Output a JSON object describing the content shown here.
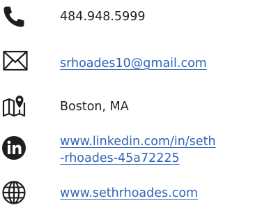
{
  "contact": {
    "phone": {
      "icon": "phone-icon",
      "text": "484.948.5999"
    },
    "email": {
      "icon": "envelope-icon",
      "text": "srhoades10@gmail.com"
    },
    "location": {
      "icon": "map-pin-icon",
      "text": "Boston, MA"
    },
    "linkedin": {
      "icon": "linkedin-icon",
      "line1": "www.linkedin.com/in/seth",
      "line2": "-rhoades-45a72225"
    },
    "website": {
      "icon": "globe-icon",
      "text": "www.sethrhoades.com"
    }
  },
  "colors": {
    "link": "#2f63b8",
    "text": "#1e1e1e",
    "icon": "#1e1e1e",
    "background": "#ffffff"
  }
}
